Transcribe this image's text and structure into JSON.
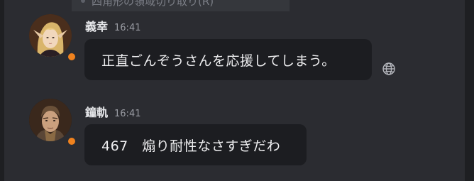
{
  "context_menu": {
    "partial_item": "四角形の領域切り取り(R)"
  },
  "messages": [
    {
      "username": "義幸",
      "time": "16:41",
      "text": "正直ごんぞうさんを応援してしまう。",
      "avatar_icon": "avatar-elf-icon",
      "status_color": "#f0821e"
    },
    {
      "username": "鐘軌",
      "time": "16:41",
      "text": "467　煽り耐性なさすぎだわ",
      "avatar_icon": "avatar-soldier-icon",
      "status_color": "#f0821e"
    }
  ],
  "actions": {
    "translate_icon": "globe-icon"
  },
  "colors": {
    "background": "#2b2c31",
    "bubble": "#1c1d21",
    "status_idle": "#f0821e"
  }
}
